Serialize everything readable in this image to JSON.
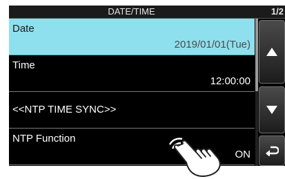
{
  "header": {
    "title": "DATE/TIME",
    "page": "1/2"
  },
  "items": [
    {
      "label": "Date",
      "value": "2019/01/01(Tue)",
      "selected": true
    },
    {
      "label": "Time",
      "value": "12:00:00"
    },
    {
      "label": "<<NTP TIME SYNC>>",
      "value": ""
    },
    {
      "label": "NTP Function",
      "value": "ON"
    }
  ],
  "buttons": {
    "up": "up-arrow-icon",
    "down": "down-arrow-icon",
    "back": "return-arrow-icon"
  },
  "icons": {
    "touch": "touch-hand-icon"
  },
  "colors": {
    "selected_bg": "#8fe0ee",
    "screen_bg": "#000000"
  }
}
